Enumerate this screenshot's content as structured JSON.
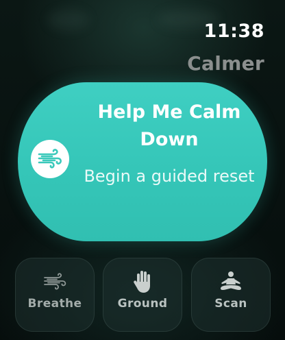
{
  "status": {
    "time": "11:38"
  },
  "app": {
    "name": "Calmer"
  },
  "hero": {
    "title": "Help Me Calm Down",
    "subtitle": "Begin a guided reset",
    "icon": "wind-icon",
    "accent_color": "#3ac9bb"
  },
  "actions": [
    {
      "label": "Breathe",
      "icon": "wind-icon"
    },
    {
      "label": "Ground",
      "icon": "hand-icon"
    },
    {
      "label": "Scan",
      "icon": "meditation-icon"
    }
  ]
}
